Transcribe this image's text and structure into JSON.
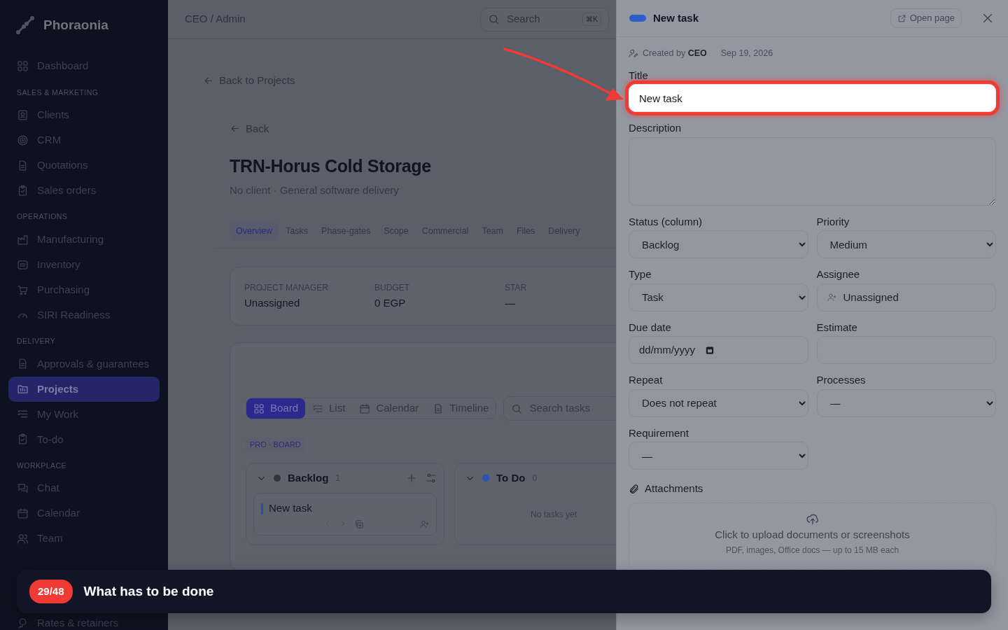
{
  "sidebar": {
    "brand": "Phoraonia",
    "items": [
      {
        "kind": "link",
        "label": "Dashboard",
        "selected": false
      },
      {
        "kind": "section",
        "label": "SALES & MARKETING"
      },
      {
        "kind": "link",
        "label": "Clients",
        "selected": false
      },
      {
        "kind": "link",
        "label": "CRM",
        "selected": false
      },
      {
        "kind": "link",
        "label": "Quotations",
        "selected": false
      },
      {
        "kind": "link",
        "label": "Sales orders",
        "selected": false
      },
      {
        "kind": "section",
        "label": "OPERATIONS"
      },
      {
        "kind": "link",
        "label": "Manufacturing",
        "selected": false
      },
      {
        "kind": "link",
        "label": "Inventory",
        "selected": false
      },
      {
        "kind": "link",
        "label": "Purchasing",
        "selected": false
      },
      {
        "kind": "link",
        "label": "SIRI Readiness",
        "selected": false
      },
      {
        "kind": "section",
        "label": "DELIVERY"
      },
      {
        "kind": "link",
        "label": "Approvals & guarantees",
        "selected": false
      },
      {
        "kind": "link",
        "label": "Projects",
        "selected": true
      },
      {
        "kind": "link",
        "label": "My Work",
        "selected": false
      },
      {
        "kind": "link",
        "label": "To-do",
        "selected": false
      },
      {
        "kind": "section",
        "label": "WORKPLACE"
      },
      {
        "kind": "link",
        "label": "Chat",
        "selected": false
      },
      {
        "kind": "link",
        "label": "Calendar",
        "selected": false
      },
      {
        "kind": "link",
        "label": "Team",
        "selected": false
      },
      {
        "kind": "bottom",
        "label": "Rates & retainers",
        "selected": false
      }
    ]
  },
  "topbar": {
    "breadcrumb": "CEO / Admin",
    "search": {
      "placeholder": "Search",
      "shortcut": "⌘K"
    }
  },
  "page": {
    "back_to_projects": "Back to Projects",
    "back": "Back",
    "title": "TRN-Horus Cold Storage",
    "subtitle": "No client · General software delivery",
    "tabs": [
      {
        "label": "Overview",
        "selected": true
      },
      {
        "label": "Tasks",
        "selected": false
      },
      {
        "label": "Phase-gates",
        "selected": false
      },
      {
        "label": "Scope",
        "selected": false
      },
      {
        "label": "Commercial",
        "selected": false
      },
      {
        "label": "Team",
        "selected": false
      },
      {
        "label": "Files",
        "selected": false
      },
      {
        "label": "Delivery",
        "selected": false
      }
    ],
    "summary": [
      {
        "label": "PROJECT MANAGER",
        "value": "Unassigned"
      },
      {
        "label": "BUDGET",
        "value": "0 EGP"
      },
      {
        "label": "STAR",
        "value": "—"
      }
    ],
    "views": [
      {
        "label": "Board",
        "selected": true
      },
      {
        "label": "List",
        "selected": false
      },
      {
        "label": "Calendar",
        "selected": false
      },
      {
        "label": "Timeline",
        "selected": false
      }
    ],
    "search_tasks": {
      "placeholder": "Search tasks"
    },
    "board_tag": "PRO · BOARD",
    "columns": [
      {
        "name": "Backlog",
        "count": "1",
        "color": "#30343f",
        "tasks": [
          {
            "title": "New task",
            "color": "#2a4fa8"
          }
        ]
      },
      {
        "name": "To Do",
        "count": "0",
        "color": "#2a52b0",
        "empty": "No tasks yet"
      }
    ]
  },
  "drawer": {
    "title": "New task",
    "color": "#2d5fc9",
    "open_page": "Open page",
    "created_label": "Created by",
    "created_by": "CEO",
    "date": "Sep 19, 2026",
    "title_field": {
      "label": "Title",
      "value": "New task",
      "highlighted": true
    },
    "description": {
      "label": "Description"
    },
    "fields": [
      {
        "kind": "select",
        "label": "Status (column)",
        "value": "Backlog"
      },
      {
        "kind": "select",
        "label": "Priority",
        "value": "Medium"
      },
      {
        "kind": "select",
        "label": "Type",
        "value": "Task"
      },
      {
        "kind": "person",
        "label": "Assignee",
        "value": "Unassigned"
      },
      {
        "kind": "date",
        "label": "Due date",
        "placeholder": "dd/mm/yyyy"
      },
      {
        "kind": "text",
        "label": "Estimate"
      },
      {
        "kind": "select",
        "label": "Repeat",
        "value": "Does not repeat"
      },
      {
        "kind": "select",
        "label": "Processes",
        "value": "—"
      },
      {
        "kind": "select",
        "label": "Requirement",
        "value": "—"
      }
    ],
    "attachments": {
      "label": "Attachments",
      "prompt": "Click to upload documents or screenshots",
      "hint": "PDF, images, Office docs — up to 15 MB each"
    }
  },
  "tour": {
    "step": "29/48",
    "caption": "What has to be done"
  }
}
